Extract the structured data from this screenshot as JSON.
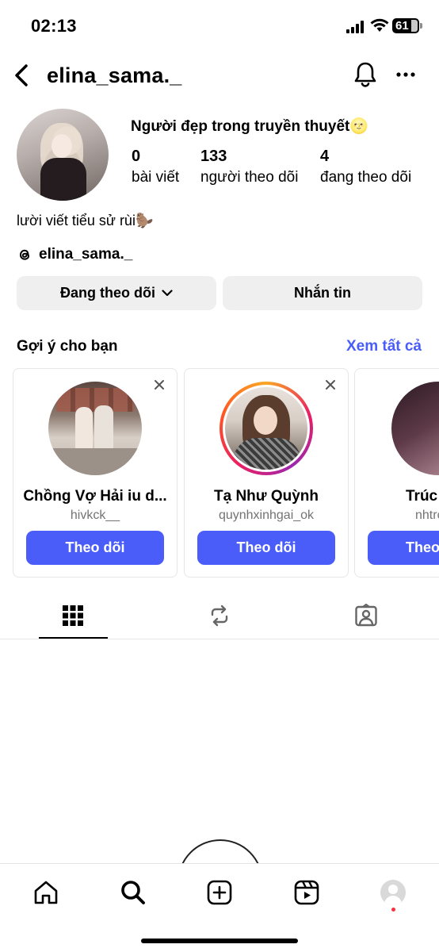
{
  "status_bar": {
    "time": "02:13",
    "battery": "61"
  },
  "header": {
    "username": "elina_sama._"
  },
  "profile": {
    "display_name": "Người đẹp trong truyền thuyết🌝",
    "stats": [
      {
        "value": "0",
        "label": "bài viết"
      },
      {
        "value": "133",
        "label": "người theo dõi"
      },
      {
        "value": "4",
        "label": "đang theo dõi"
      }
    ],
    "bio": "lười viết tiểu sử rùi🦫",
    "threads_handle": "elina_sama._"
  },
  "actions": {
    "following_label": "Đang theo dõi",
    "message_label": "Nhắn tin"
  },
  "suggestions": {
    "title": "Gợi ý cho bạn",
    "see_all": "Xem tất cả",
    "cards": [
      {
        "name": "Chồng Vợ Hải iu d...",
        "handle": "hivkck__",
        "button": "Theo dõi"
      },
      {
        "name": "Tạ Như Quỳnh",
        "handle": "quynhxinhgai_ok",
        "button": "Theo dõi"
      },
      {
        "name": "Trúc",
        "handle": "nhtrc",
        "button": "Theo"
      }
    ]
  },
  "tabs": [
    "grid-icon",
    "reposts-icon",
    "tagged-icon"
  ],
  "bottom_nav": [
    "home-icon",
    "search-icon",
    "create-icon",
    "reels-icon",
    "profile-avatar"
  ],
  "colors": {
    "accent": "#4a5df9",
    "button_gray": "#efefef",
    "notification": "#ff3040"
  }
}
